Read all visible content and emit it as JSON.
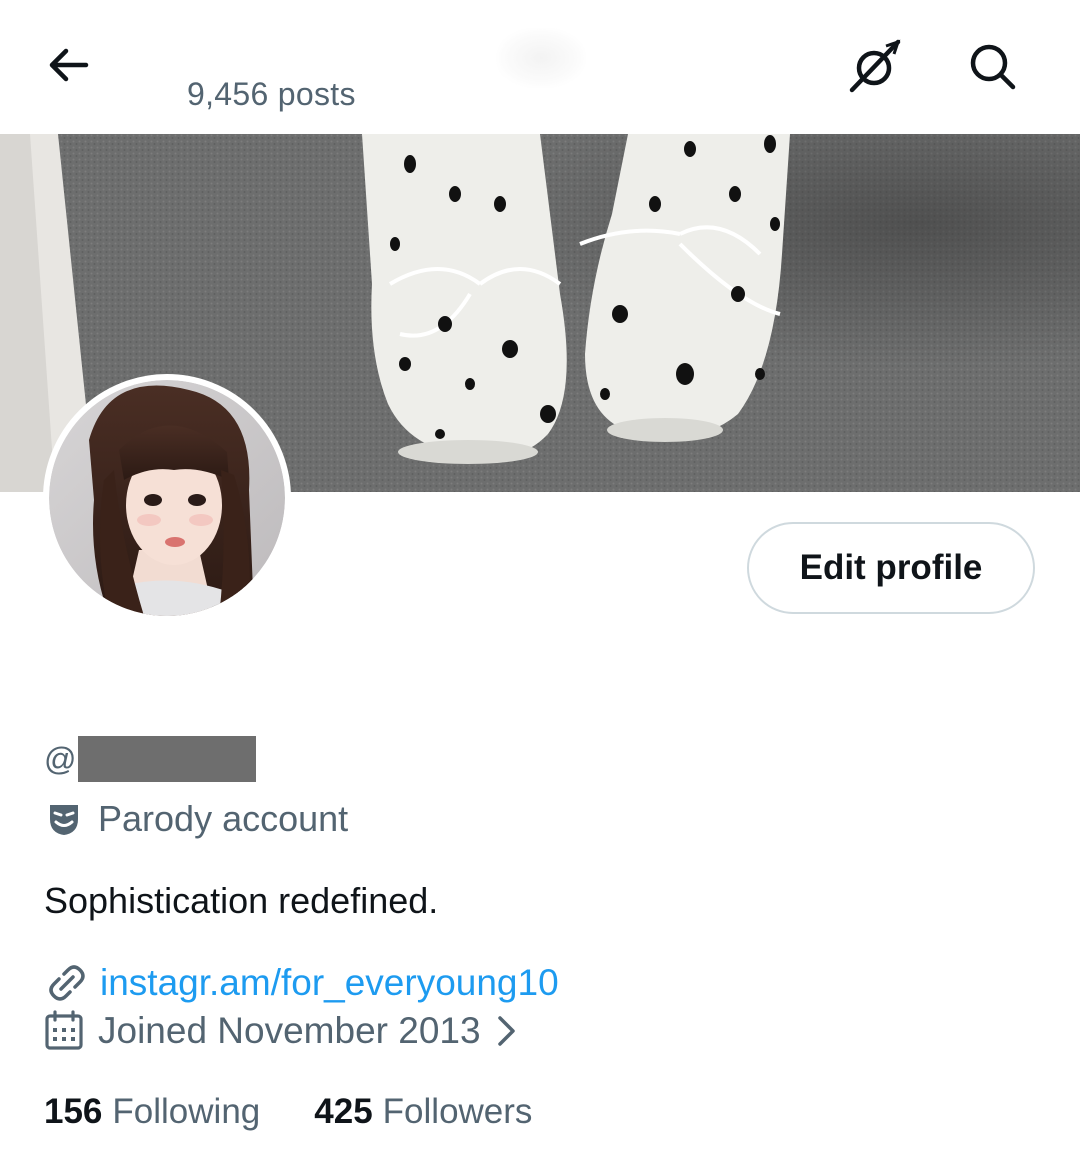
{
  "header": {
    "posts_count": "9,456 posts",
    "back_icon": "arrow-left-icon",
    "grok_icon": "grok-icon",
    "search_icon": "search-icon"
  },
  "profile": {
    "edit_button_label": "Edit profile",
    "handle_prefix": "@",
    "parody_label": "Parody account",
    "bio": "Sophistication redefined.",
    "link": "instagr.am/for_everyoung10",
    "joined": "Joined November 2013",
    "following_count": "156",
    "following_label": "Following",
    "followers_count": "425",
    "followers_label": "Followers"
  },
  "colors": {
    "accent": "#1d9bf0",
    "secondary_text": "#536471",
    "primary_text": "#0f1419"
  }
}
